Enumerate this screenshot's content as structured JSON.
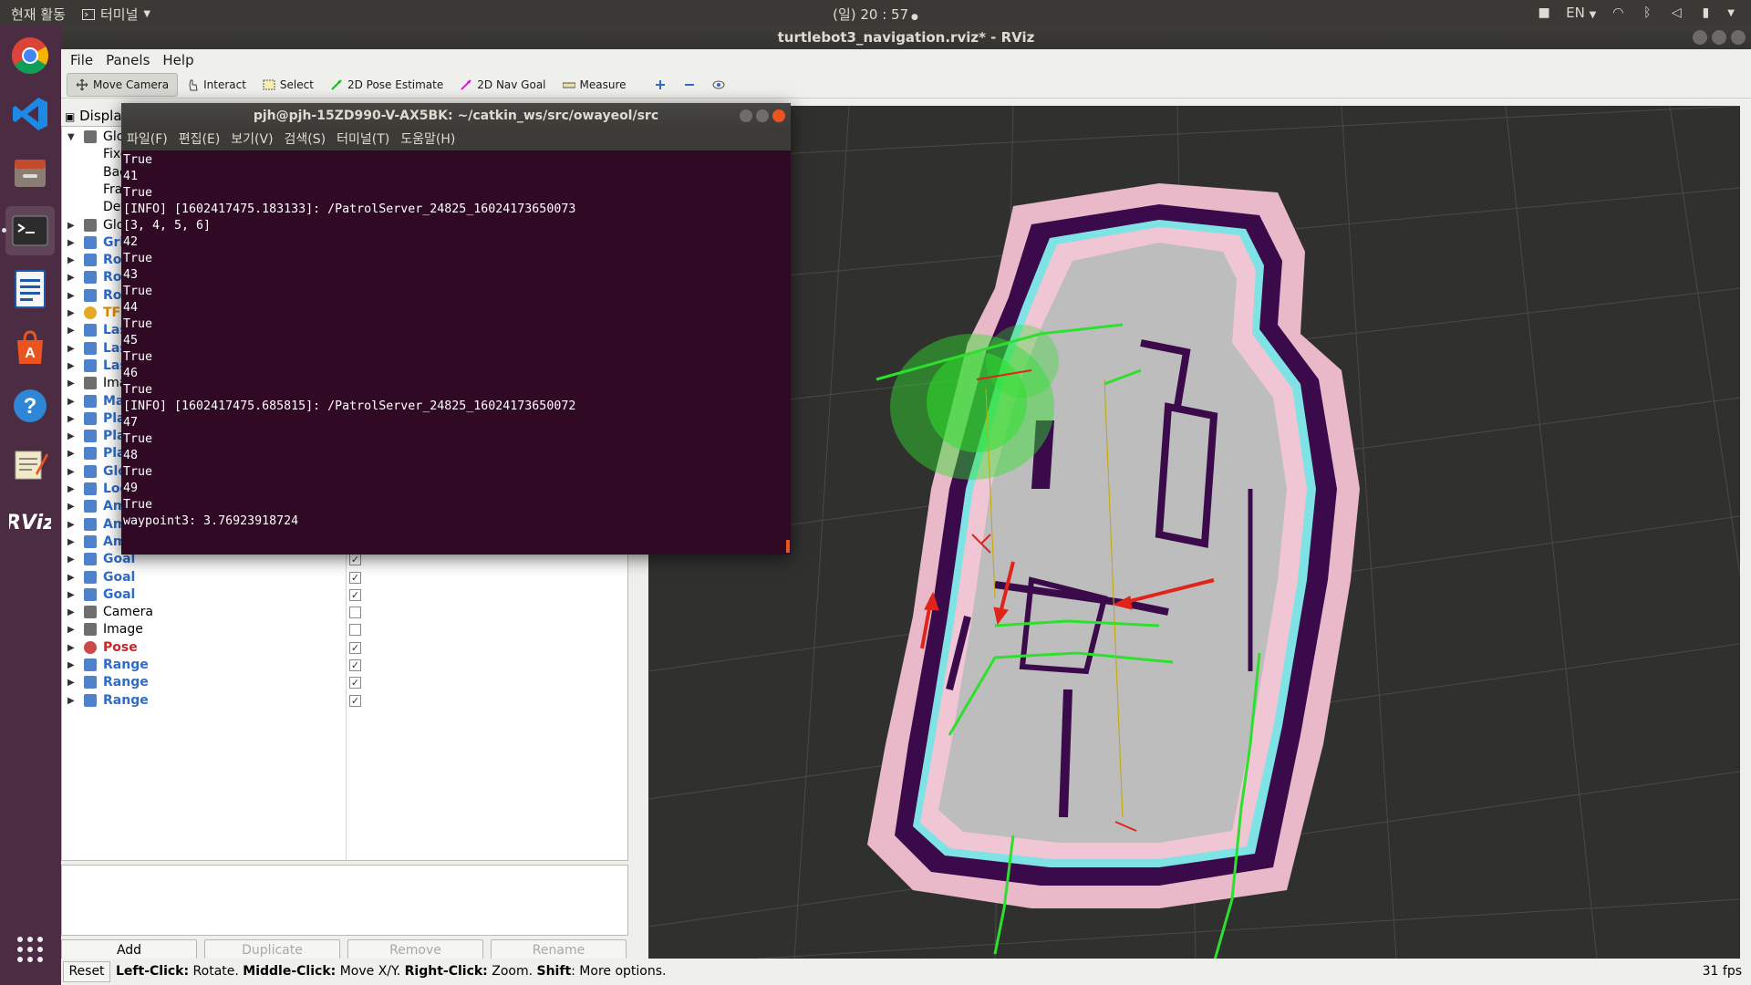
{
  "topbar": {
    "activities": "현재 활동",
    "app_menu": "터미널",
    "clock": "(일) 20 : 57",
    "lang": "EN"
  },
  "launcher": {
    "items": [
      "chrome-icon",
      "vscode-icon",
      "files-icon",
      "terminal-icon",
      "writer-icon",
      "software-icon",
      "help-icon",
      "editor-icon",
      "rviz-icon",
      "app-grid-icon"
    ]
  },
  "rviz": {
    "title": "turtlebot3_navigation.rviz* - RViz",
    "menu": [
      "File",
      "Panels",
      "Help"
    ],
    "tools": [
      {
        "label": "Move Camera",
        "active": true
      },
      {
        "label": "Interact"
      },
      {
        "label": "Select"
      },
      {
        "label": "2D Pose Estimate"
      },
      {
        "label": "2D Nav Goal"
      },
      {
        "label": "Measure"
      }
    ],
    "displays_title": "Displa",
    "rows": [
      {
        "label": "Glo",
        "style": "",
        "expanded": true,
        "check": null
      },
      {
        "label": "Fixe",
        "style": "child",
        "check": null
      },
      {
        "label": "Bac",
        "style": "child",
        "check": null
      },
      {
        "label": "Fra",
        "style": "child",
        "check": null
      },
      {
        "label": "Def",
        "style": "child",
        "check": null
      },
      {
        "label": "Glo",
        "style": "",
        "check": null
      },
      {
        "label": "Gri",
        "style": "blue",
        "check": null
      },
      {
        "label": "Ro",
        "style": "blue",
        "check": null
      },
      {
        "label": "Ro",
        "style": "blue",
        "check": null
      },
      {
        "label": "Ro",
        "style": "blue",
        "check": null
      },
      {
        "label": "TF",
        "style": "orange",
        "check": null
      },
      {
        "label": "Las",
        "style": "blue",
        "check": null
      },
      {
        "label": "Las",
        "style": "blue",
        "check": null
      },
      {
        "label": "Las",
        "style": "blue",
        "check": null
      },
      {
        "label": "Ima",
        "style": "",
        "check": null
      },
      {
        "label": "Ma",
        "style": "blue",
        "check": null
      },
      {
        "label": "Pla",
        "style": "blue",
        "check": null
      },
      {
        "label": "Pla",
        "style": "blue",
        "check": null
      },
      {
        "label": "Pla",
        "style": "blue",
        "check": null
      },
      {
        "label": "Glo",
        "style": "blue",
        "check": null
      },
      {
        "label": "Loc",
        "style": "blue",
        "check": null
      },
      {
        "label": "Am",
        "style": "blue",
        "check": null
      },
      {
        "label": "Am",
        "style": "blue",
        "check": null
      },
      {
        "label": "Am",
        "style": "blue",
        "check": null
      },
      {
        "label": "Goal",
        "style": "blue",
        "check": true
      },
      {
        "label": "Goal",
        "style": "blue",
        "check": true
      },
      {
        "label": "Goal",
        "style": "blue",
        "check": true
      },
      {
        "label": "Camera",
        "style": "",
        "check": false
      },
      {
        "label": "Image",
        "style": "",
        "check": false
      },
      {
        "label": "Pose",
        "style": "red",
        "check": true
      },
      {
        "label": "Range",
        "style": "blue",
        "check": true
      },
      {
        "label": "Range",
        "style": "blue",
        "check": true
      },
      {
        "label": "Range",
        "style": "blue",
        "check": true
      }
    ],
    "buttons": {
      "add": "Add",
      "duplicate": "Duplicate",
      "remove": "Remove",
      "rename": "Rename"
    },
    "status": {
      "reset": "Reset",
      "hint_parts": [
        {
          "b": "Left-Click:",
          "t": " Rotate. "
        },
        {
          "b": "Middle-Click:",
          "t": " Move X/Y. "
        },
        {
          "b": "Right-Click:",
          "t": " Zoom. "
        },
        {
          "b": "Shift",
          "t": ": More options."
        }
      ],
      "fps": "31 fps"
    }
  },
  "terminal": {
    "title": "pjh@pjh-15ZD990-V-AX5BK: ~/catkin_ws/src/owayeol/src",
    "menu": [
      "파일(F)",
      "편집(E)",
      "보기(V)",
      "검색(S)",
      "터미널(T)",
      "도움말(H)"
    ],
    "lines": [
      "True",
      "41",
      "True",
      "[INFO] [1602417475.183133]: /PatrolServer_24825_16024173650073",
      "[3, 4, 5, 6]",
      "42",
      "True",
      "43",
      "True",
      "44",
      "True",
      "45",
      "True",
      "46",
      "True",
      "[INFO] [1602417475.685815]: /PatrolServer_24825_16024173650072",
      "47",
      "True",
      "48",
      "True",
      "49",
      "True",
      "waypoint3: 3.76923918724"
    ]
  },
  "colors": {
    "terminal_bg": "#300a24",
    "launcher_bg": "#4b2c43",
    "view_bg": "#30302f",
    "costmap_wall": "#3a0a4a",
    "costmap_inflation": "#f0c6d4",
    "costmap_free": "#bdbdbd",
    "costmap_edge": "#7fe3e6",
    "laser": "#2ee02e",
    "goal_arrow": "#e0241c"
  }
}
